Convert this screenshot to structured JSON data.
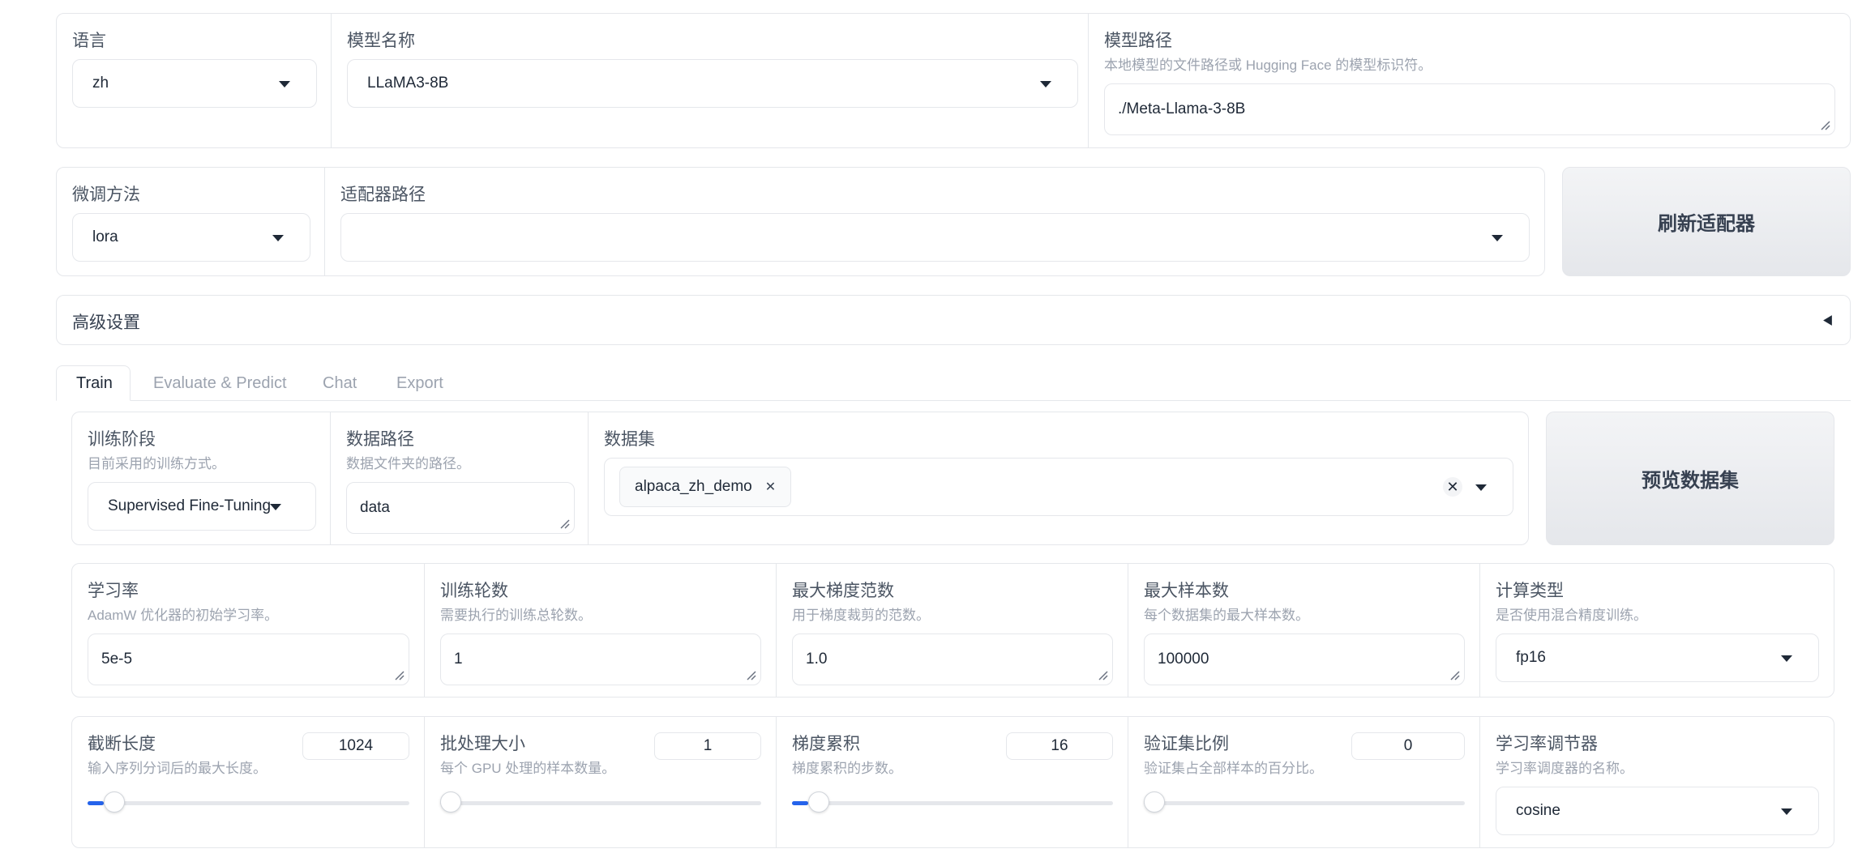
{
  "model_row": {
    "lang": {
      "label": "语言",
      "value": "zh"
    },
    "model_name": {
      "label": "模型名称",
      "value": "LLaMA3-8B"
    },
    "model_path": {
      "label": "模型路径",
      "info": "本地模型的文件路径或 Hugging Face 的模型标识符。",
      "value": "./Meta-Llama-3-8B"
    }
  },
  "finetune_row": {
    "method": {
      "label": "微调方法",
      "value": "lora"
    },
    "adapter": {
      "label": "适配器路径",
      "value": ""
    },
    "refresh_button": "刷新适配器"
  },
  "advanced": {
    "label": "高级设置",
    "collapsed": true
  },
  "tabs": [
    {
      "label": "Train",
      "selected": true
    },
    {
      "label": "Evaluate & Predict",
      "selected": false
    },
    {
      "label": "Chat",
      "selected": false
    },
    {
      "label": "Export",
      "selected": false
    }
  ],
  "train": {
    "stage": {
      "label": "训练阶段",
      "info": "目前采用的训练方式。",
      "value": "Supervised Fine-Tuning"
    },
    "dataset_dir": {
      "label": "数据路径",
      "info": "数据文件夹的路径。",
      "value": "data"
    },
    "dataset": {
      "label": "数据集",
      "tags": [
        "alpaca_zh_demo"
      ]
    },
    "preview_button": "预览数据集",
    "learning_rate": {
      "label": "学习率",
      "info": "AdamW 优化器的初始学习率。",
      "value": "5e-5"
    },
    "epochs": {
      "label": "训练轮数",
      "info": "需要执行的训练总轮数。",
      "value": "1"
    },
    "max_grad_norm": {
      "label": "最大梯度范数",
      "info": "用于梯度裁剪的范数。",
      "value": "1.0"
    },
    "max_samples": {
      "label": "最大样本数",
      "info": "每个数据集的最大样本数。",
      "value": "100000"
    },
    "compute_type": {
      "label": "计算类型",
      "info": "是否使用混合精度训练。",
      "value": "fp16"
    },
    "cutoff_len": {
      "label": "截断长度",
      "info": "输入序列分词后的最大长度。",
      "value": "1024",
      "slider_fraction": 0.05
    },
    "batch_size": {
      "label": "批处理大小",
      "info": "每个 GPU 处理的样本数量。",
      "value": "1",
      "slider_fraction": 0.0
    },
    "grad_accum": {
      "label": "梯度累积",
      "info": "梯度累积的步数。",
      "value": "16",
      "slider_fraction": 0.05
    },
    "val_size": {
      "label": "验证集比例",
      "info": "验证集占全部样本的百分比。",
      "value": "0",
      "slider_fraction": 0.0
    },
    "lr_scheduler": {
      "label": "学习率调节器",
      "info": "学习率调度器的名称。",
      "value": "cosine"
    }
  },
  "colors": {
    "accent": "#2563eb",
    "border": "#e5e7eb",
    "text": "#374151",
    "muted": "#9ca3af"
  }
}
